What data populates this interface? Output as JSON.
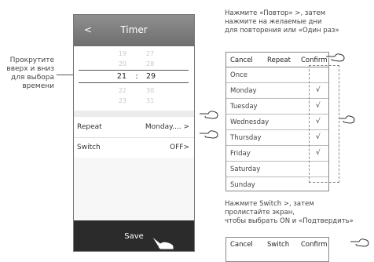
{
  "phone": {
    "back": "<",
    "title": "Timer",
    "hours": [
      "19",
      "20",
      "21",
      "22",
      "23"
    ],
    "colon": ":",
    "minutes": [
      "27",
      "28",
      "29",
      "30",
      "31"
    ],
    "repeat_label": "Repeat",
    "repeat_value": "Monday.... >",
    "switch_label": "Switch",
    "switch_value": "OFF>",
    "save": "Save"
  },
  "left_caption": [
    "Прокрутите",
    "вверх и вниз",
    "для выбора",
    "времени"
  ],
  "repeat_caption": [
    "Нажмите «Повтор» >, затем",
    "нажмите на желаемые дни",
    "для повторения или «Один раз»"
  ],
  "repeat_list": {
    "cancel": "Cancel",
    "title": "Repeat",
    "confirm": "Confirm",
    "days": [
      {
        "label": "Once",
        "checked": false
      },
      {
        "label": "Monday",
        "checked": true
      },
      {
        "label": "Tuesday",
        "checked": true
      },
      {
        "label": "Wednesday",
        "checked": true
      },
      {
        "label": "Thursday",
        "checked": true
      },
      {
        "label": "Friday",
        "checked": true
      },
      {
        "label": "Saturday",
        "checked": false
      },
      {
        "label": "Sunday",
        "checked": false
      }
    ],
    "check_mark": "√"
  },
  "switch_caption": [
    "Нажмите Switch >, затем",
    "пролистайте экран,",
    "чтобы выбрать ON и «Подтвердить»"
  ],
  "switch_list": {
    "cancel": "Cancel",
    "title": "Switch",
    "confirm": "Confirm"
  },
  "colors": {
    "header_bg": "#7d7d7d",
    "footer_bg": "#2b2b2b",
    "text": "#333333"
  },
  "icons": [
    "hand-pointer-icon"
  ]
}
